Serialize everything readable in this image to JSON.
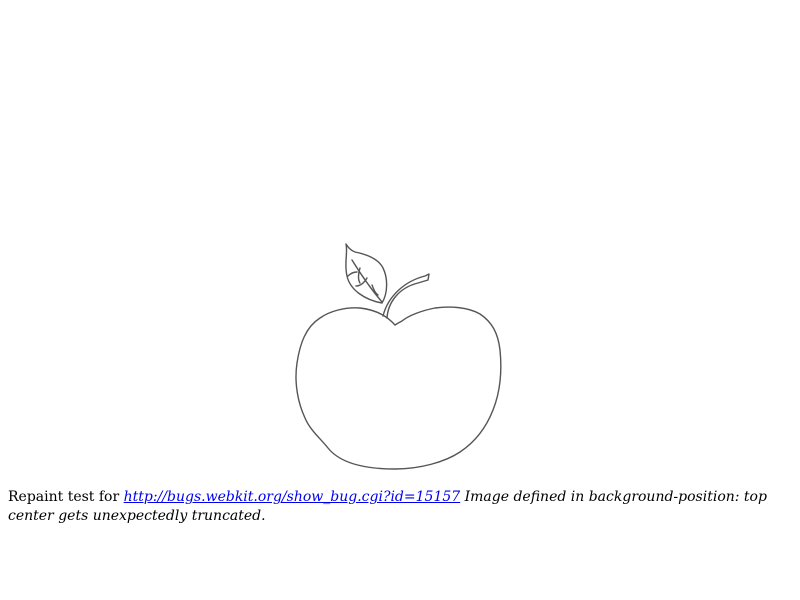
{
  "page": {
    "caption_prefix": "Repaint test for",
    "link_text": "http://bugs.webkit.org/show_bug.cgi?id=15157",
    "description": "Image defined in background-position: top center gets unexpectedly truncated."
  },
  "illustration": {
    "icon": "apple-drawing",
    "stroke_color": "#555555",
    "background_color": "#ffffff"
  }
}
